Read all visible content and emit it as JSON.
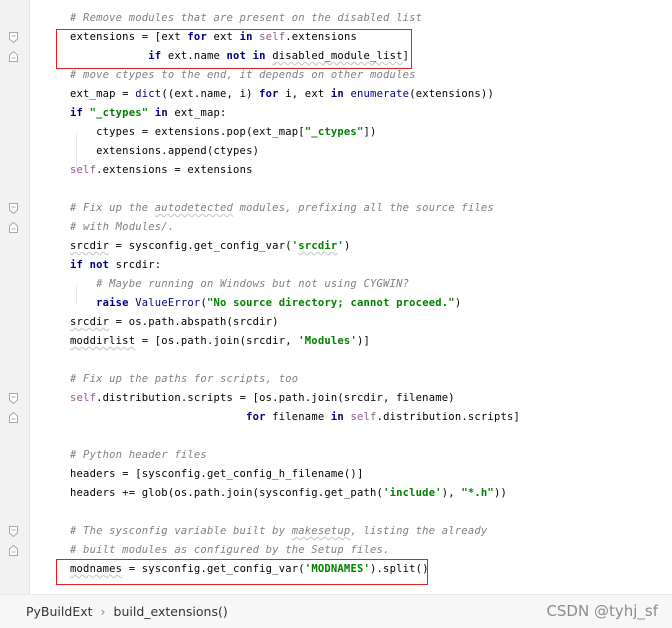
{
  "code_lines": [
    [
      {
        "c": "cm",
        "t": "# Remove modules that are present on the disabled list"
      }
    ],
    [
      {
        "c": "",
        "t": "extensions = ["
      },
      {
        "c": "",
        "t": "ext "
      },
      {
        "c": "kw",
        "t": "for"
      },
      {
        "c": "",
        "t": " ext "
      },
      {
        "c": "kw",
        "t": "in"
      },
      {
        "c": "",
        "t": " "
      },
      {
        "c": "sf",
        "t": "self"
      },
      {
        "c": "",
        "t": ".extensions"
      }
    ],
    [
      {
        "c": "",
        "t": "            "
      },
      {
        "c": "kw",
        "t": "if"
      },
      {
        "c": "",
        "t": " ext.name "
      },
      {
        "c": "kw",
        "t": "not in"
      },
      {
        "c": "",
        "t": " "
      },
      {
        "c": "ul",
        "t": "disabled_module_list"
      },
      {
        "c": "",
        "t": "]"
      }
    ],
    [
      {
        "c": "cm",
        "t": "# move ctypes to the end, it depends on other modules"
      }
    ],
    [
      {
        "c": "",
        "t": "ext_map = "
      },
      {
        "c": "bi",
        "t": "dict"
      },
      {
        "c": "",
        "t": "((ext.name, i) "
      },
      {
        "c": "kw",
        "t": "for"
      },
      {
        "c": "",
        "t": " i, ext "
      },
      {
        "c": "kw",
        "t": "in"
      },
      {
        "c": "",
        "t": " "
      },
      {
        "c": "bi",
        "t": "enumerate"
      },
      {
        "c": "",
        "t": "(extensions))"
      }
    ],
    [
      {
        "c": "kw",
        "t": "if"
      },
      {
        "c": "",
        "t": " "
      },
      {
        "c": "st",
        "t": "\"_ctypes\""
      },
      {
        "c": "",
        "t": " "
      },
      {
        "c": "kw",
        "t": "in"
      },
      {
        "c": "",
        "t": " ext_map:"
      }
    ],
    [
      {
        "c": "",
        "t": "    ctypes = extensions.pop(ext_map["
      },
      {
        "c": "st",
        "t": "\"_ctypes\""
      },
      {
        "c": "",
        "t": "])"
      }
    ],
    [
      {
        "c": "",
        "t": "    extensions.append(ctypes)"
      }
    ],
    [
      {
        "c": "sf",
        "t": "self"
      },
      {
        "c": "",
        "t": ".extensions = extensions"
      }
    ],
    [],
    [
      {
        "c": "cm",
        "t": "# Fix up the "
      },
      {
        "c": "cm ul",
        "t": "autodetected"
      },
      {
        "c": "cm",
        "t": " modules, prefixing all the source files"
      }
    ],
    [
      {
        "c": "cm",
        "t": "# with Modules/."
      }
    ],
    [
      {
        "c": "ul",
        "t": "srcdir"
      },
      {
        "c": "",
        "t": " = sysconfig.get_config_var("
      },
      {
        "c": "st",
        "t": "'"
      },
      {
        "c": "st ul",
        "t": "srcdir"
      },
      {
        "c": "st",
        "t": "'"
      },
      {
        "c": "",
        "t": ")"
      }
    ],
    [
      {
        "c": "kw",
        "t": "if not"
      },
      {
        "c": "",
        "t": " srcdir:"
      }
    ],
    [
      {
        "c": "cm",
        "t": "    # Maybe running on Windows but not using CYGWIN?"
      }
    ],
    [
      {
        "c": "",
        "t": "    "
      },
      {
        "c": "kw",
        "t": "raise"
      },
      {
        "c": "",
        "t": " "
      },
      {
        "c": "cls",
        "t": "ValueError"
      },
      {
        "c": "",
        "t": "("
      },
      {
        "c": "st",
        "t": "\"No source directory; cannot proceed.\""
      },
      {
        "c": "",
        "t": ")"
      }
    ],
    [
      {
        "c": "ul",
        "t": "srcdir"
      },
      {
        "c": "",
        "t": " = os.path.abspath(srcdir)"
      }
    ],
    [
      {
        "c": "ul",
        "t": "moddirlist"
      },
      {
        "c": "",
        "t": " = [os.path.join(srcdir, "
      },
      {
        "c": "st",
        "t": "'Modules'"
      },
      {
        "c": "",
        "t": ")]"
      }
    ],
    [],
    [
      {
        "c": "cm",
        "t": "# Fix up the paths for scripts, too"
      }
    ],
    [
      {
        "c": "sf",
        "t": "self"
      },
      {
        "c": "",
        "t": ".distribution.scripts = [os.path.join(srcdir, filename)"
      }
    ],
    [
      {
        "c": "",
        "t": "                           "
      },
      {
        "c": "kw",
        "t": "for"
      },
      {
        "c": "",
        "t": " filename "
      },
      {
        "c": "kw",
        "t": "in"
      },
      {
        "c": "",
        "t": " "
      },
      {
        "c": "sf",
        "t": "self"
      },
      {
        "c": "",
        "t": ".distribution.scripts]"
      }
    ],
    [],
    [
      {
        "c": "cm",
        "t": "# Python header files"
      }
    ],
    [
      {
        "c": "",
        "t": "headers = [sysconfig.get_config_h_filename()]"
      }
    ],
    [
      {
        "c": "",
        "t": "headers += glob(os.path.join(sysconfig.get_path("
      },
      {
        "c": "st",
        "t": "'include'"
      },
      {
        "c": "",
        "t": "), "
      },
      {
        "c": "st",
        "t": "\"*.h\""
      },
      {
        "c": "",
        "t": "))"
      }
    ],
    [],
    [
      {
        "c": "cm",
        "t": "# The sysconfig variable built by "
      },
      {
        "c": "cm ul",
        "t": "makesetup"
      },
      {
        "c": "cm",
        "t": ", listing the already"
      }
    ],
    [
      {
        "c": "cm",
        "t": "# built modules as configured by the Setup files."
      }
    ],
    [
      {
        "c": "ul",
        "t": "modnames"
      },
      {
        "c": "",
        "t": " = sysconfig.get_config_var("
      },
      {
        "c": "st",
        "t": "'MODNAMES'"
      },
      {
        "c": "",
        "t": ").split()"
      }
    ]
  ],
  "fold_markers": {
    "1": "open",
    "2": "close",
    "10": "open",
    "11": "close",
    "20": "open",
    "21": "close",
    "27": "open",
    "28": "close"
  },
  "highlight_boxes": [
    {
      "label": "list comprehension filter"
    },
    {
      "label": "modnames assignment"
    }
  ],
  "status": {
    "breadcrumb_file": "PyBuildExt",
    "breadcrumb_sep": "›",
    "breadcrumb_method": "build_extensions()",
    "watermark": "CSDN @tyhj_sf"
  },
  "colors": {
    "keyword": "#000080",
    "comment": "#808080",
    "string": "#008000",
    "self": "#94558d",
    "highlight_box": "#e02020"
  }
}
